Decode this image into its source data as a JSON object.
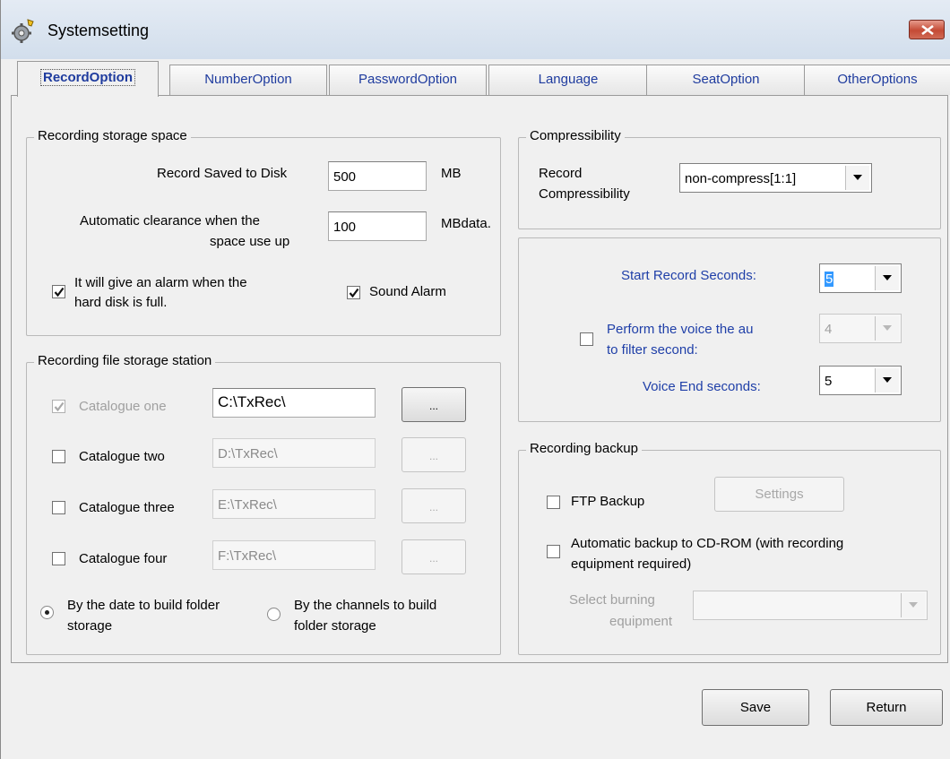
{
  "window": {
    "title": "Systemsetting"
  },
  "tabs": [
    {
      "label": "RecordOption",
      "active": true
    },
    {
      "label": "NumberOption"
    },
    {
      "label": "PasswordOption"
    },
    {
      "label": "Language"
    },
    {
      "label": "SeatOption"
    },
    {
      "label": "OtherOptions"
    }
  ],
  "storage_space": {
    "legend": "Recording storage space",
    "saved_label": "Record Saved to Disk",
    "saved_value": "500",
    "saved_unit": "MB",
    "clear_label_1": "Automatic clearance when the",
    "clear_label_2": "space use up",
    "clear_value": "100",
    "clear_unit": "MBdata.",
    "alarm_label_1": "It will give an alarm when the",
    "alarm_label_2": "hard disk is full.",
    "alarm_checked": true,
    "sound_label": "Sound Alarm",
    "sound_checked": true
  },
  "file_station": {
    "legend": "Recording file storage station",
    "catalogues": [
      {
        "label": "Catalogue one",
        "path": "C:\\TxRec\\",
        "checked": true,
        "enabled": false
      },
      {
        "label": "Catalogue two",
        "path": "D:\\TxRec\\",
        "checked": false,
        "enabled": true
      },
      {
        "label": "Catalogue three",
        "path": "E:\\TxRec\\",
        "checked": false,
        "enabled": true
      },
      {
        "label": "Catalogue four",
        "path": "F:\\TxRec\\",
        "checked": false,
        "enabled": true
      }
    ],
    "browse_label": "...",
    "radio_date_1": "By the date to build folder",
    "radio_date_2": "storage",
    "radio_channel_1": "By the channels to build",
    "radio_channel_2": "folder storage",
    "selected": "date"
  },
  "compress": {
    "legend": "Compressibility",
    "label_1": "Record",
    "label_2": "Compressibility",
    "value": "non-compress[1:1]"
  },
  "record_seconds": {
    "start_label": "Start Record Seconds:",
    "start_value": "5",
    "filter_label_1": "Perform the voice the au",
    "filter_label_2": "to filter second:",
    "filter_checked": false,
    "filter_value": "4",
    "end_label": "Voice End seconds:",
    "end_value": "5"
  },
  "backup": {
    "legend": "Recording backup",
    "ftp_label": "FTP Backup",
    "ftp_checked": false,
    "settings_label": "Settings",
    "cd_label_1": "Automatic backup to CD-ROM (with recording",
    "cd_label_2": "equipment required)",
    "cd_checked": false,
    "burn_label_1": "Select burning",
    "burn_label_2": "equipment",
    "burn_value": ""
  },
  "footer": {
    "save_label": "Save",
    "return_label": "Return"
  }
}
